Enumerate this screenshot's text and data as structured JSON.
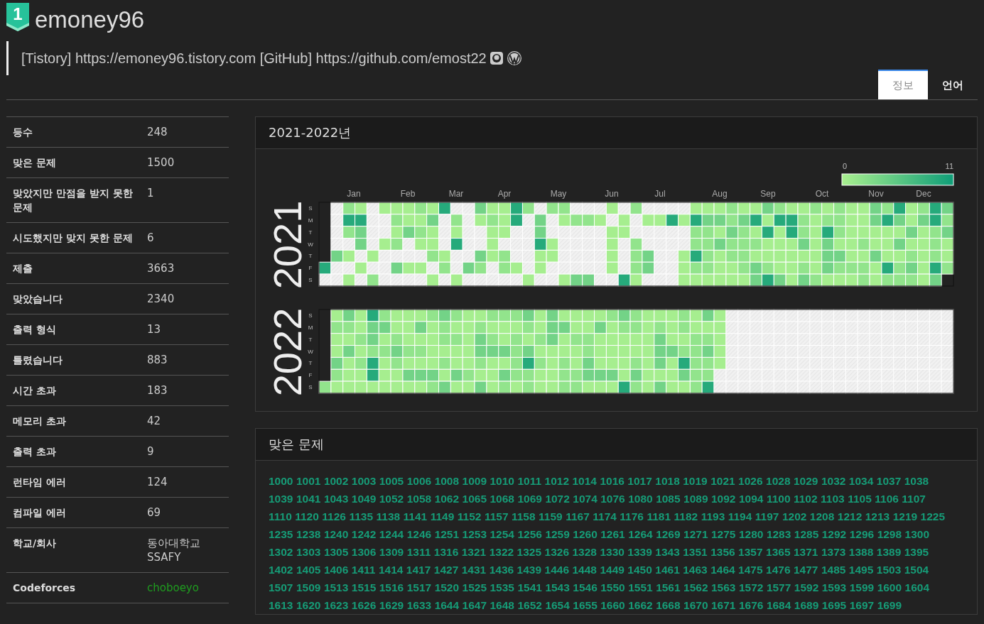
{
  "profile": {
    "tier_badge": "1",
    "username": "emoney96",
    "bio": "[Tistory] https://emoney96.tistory.com [GitHub] https://github.com/emost22"
  },
  "tabs": [
    {
      "label": "정보",
      "selected": true
    },
    {
      "label": "언어",
      "selected": false
    }
  ],
  "stats": [
    {
      "label": "등수",
      "values": [
        "248"
      ]
    },
    {
      "label": "맞은 문제",
      "values": [
        "1500"
      ]
    },
    {
      "label": "맞았지만 만점을 받지 못한 문제",
      "values": [
        "1"
      ]
    },
    {
      "label": "시도했지만 맞지 못한 문제",
      "values": [
        "6"
      ]
    },
    {
      "label": "제출",
      "values": [
        "3663"
      ]
    },
    {
      "label": "맞았습니다",
      "values": [
        "2340"
      ]
    },
    {
      "label": "출력 형식",
      "values": [
        "13"
      ]
    },
    {
      "label": "틀렸습니다",
      "values": [
        "883"
      ]
    },
    {
      "label": "시간 초과",
      "values": [
        "183"
      ]
    },
    {
      "label": "메모리 초과",
      "values": [
        "42"
      ]
    },
    {
      "label": "출력 초과",
      "values": [
        "9"
      ]
    },
    {
      "label": "런타임 에러",
      "values": [
        "124"
      ]
    },
    {
      "label": "컴파일 에러",
      "values": [
        "69"
      ]
    },
    {
      "label": "학교/회사",
      "values": [
        "동아대학교",
        "SSAFY"
      ]
    },
    {
      "label": "Codeforces",
      "values": [
        "choboeyo"
      ],
      "kind": "link"
    }
  ],
  "heatmap_panel": {
    "title": "2021-2022년",
    "legend_min": "0",
    "legend_max": "11",
    "months": [
      "Jan",
      "Feb",
      "Mar",
      "Apr",
      "May",
      "Jun",
      "Jul",
      "Aug",
      "Sep",
      "Oct",
      "Nov",
      "Dec"
    ],
    "years": [
      {
        "label": "2021",
        "weekdays": [
          "S",
          "M",
          "T",
          "W",
          "T",
          "F",
          "S"
        ]
      },
      {
        "label": "2022",
        "weekdays": [
          "S",
          "M",
          "T",
          "W",
          "T",
          "F",
          "S"
        ]
      }
    ]
  },
  "solved_panel": {
    "title": "맞은 문제",
    "problems": [
      "1000",
      "1001",
      "1002",
      "1003",
      "1005",
      "1006",
      "1008",
      "1009",
      "1010",
      "1011",
      "1012",
      "1014",
      "1016",
      "1017",
      "1018",
      "1019",
      "1021",
      "1026",
      "1028",
      "1029",
      "1032",
      "1034",
      "1037",
      "1038",
      "1039",
      "1041",
      "1043",
      "1049",
      "1052",
      "1058",
      "1062",
      "1065",
      "1068",
      "1069",
      "1072",
      "1074",
      "1076",
      "1080",
      "1085",
      "1089",
      "1092",
      "1094",
      "1100",
      "1102",
      "1103",
      "1105",
      "1106",
      "1107",
      "1110",
      "1120",
      "1126",
      "1135",
      "1138",
      "1141",
      "1149",
      "1152",
      "1157",
      "1158",
      "1159",
      "1167",
      "1174",
      "1176",
      "1181",
      "1182",
      "1193",
      "1194",
      "1197",
      "1202",
      "1208",
      "1212",
      "1213",
      "1219",
      "1225",
      "1235",
      "1238",
      "1240",
      "1242",
      "1244",
      "1246",
      "1251",
      "1253",
      "1254",
      "1256",
      "1259",
      "1260",
      "1261",
      "1264",
      "1269",
      "1271",
      "1275",
      "1280",
      "1283",
      "1285",
      "1292",
      "1296",
      "1298",
      "1300",
      "1302",
      "1303",
      "1305",
      "1306",
      "1309",
      "1311",
      "1316",
      "1321",
      "1322",
      "1325",
      "1326",
      "1328",
      "1330",
      "1339",
      "1343",
      "1351",
      "1356",
      "1357",
      "1365",
      "1371",
      "1373",
      "1388",
      "1389",
      "1395",
      "1402",
      "1405",
      "1406",
      "1411",
      "1414",
      "1417",
      "1427",
      "1431",
      "1436",
      "1439",
      "1446",
      "1448",
      "1449",
      "1450",
      "1461",
      "1463",
      "1464",
      "1475",
      "1476",
      "1477",
      "1485",
      "1495",
      "1503",
      "1504",
      "1507",
      "1509",
      "1513",
      "1515",
      "1516",
      "1517",
      "1520",
      "1525",
      "1535",
      "1541",
      "1543",
      "1546",
      "1550",
      "1551",
      "1561",
      "1562",
      "1563",
      "1572",
      "1577",
      "1592",
      "1593",
      "1599",
      "1600",
      "1604",
      "1613",
      "1620",
      "1623",
      "1626",
      "1629",
      "1633",
      "1644",
      "1647",
      "1648",
      "1652",
      "1654",
      "1655",
      "1660",
      "1662",
      "1668",
      "1670",
      "1671",
      "1676",
      "1684",
      "1689",
      "1695",
      "1697",
      "1699"
    ]
  }
}
